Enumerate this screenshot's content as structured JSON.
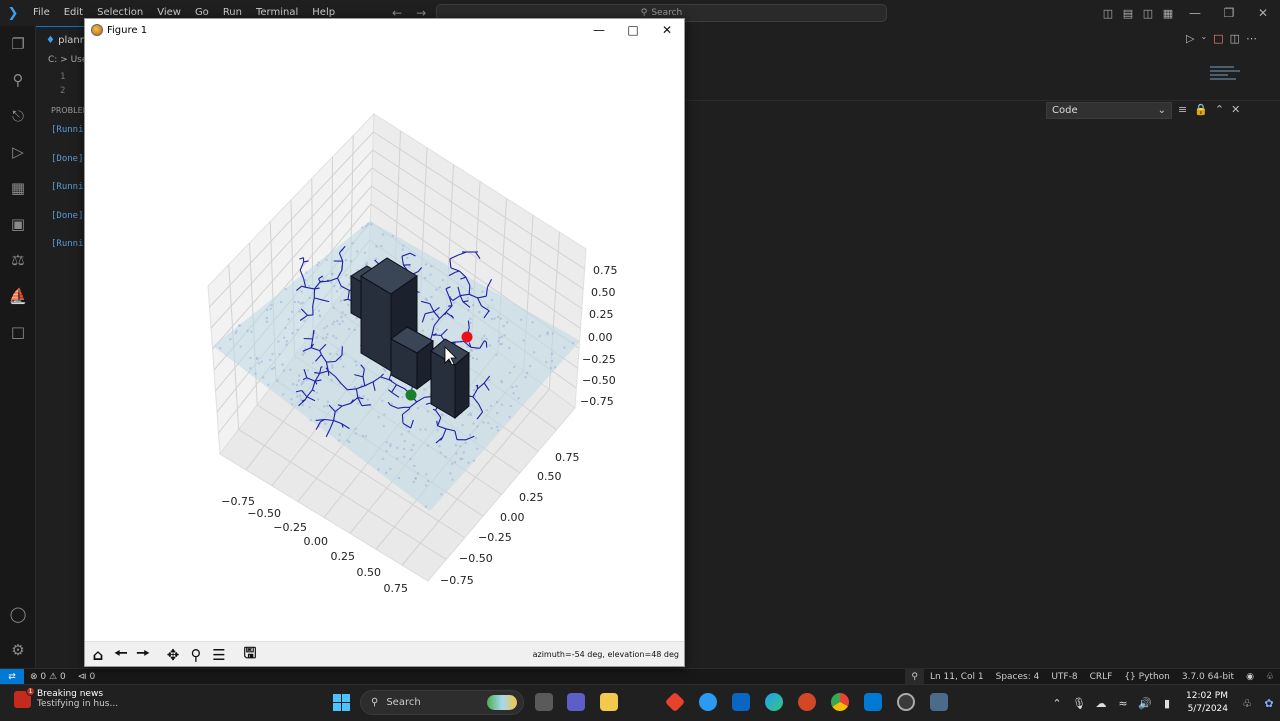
{
  "vscode": {
    "menu": [
      "File",
      "Edit",
      "Selection",
      "View",
      "Go",
      "Run",
      "Terminal",
      "Help"
    ],
    "search_placeholder": "Search",
    "editor_tab": "plann",
    "breadcrumb": "C: > Use",
    "line_numbers": [
      "1",
      "2"
    ],
    "panel_title": "PROBLEM",
    "output_lines": [
      "[Runni",
      "[Done]",
      "[Runni",
      "[Done]",
      "[Runni"
    ],
    "output_channel": "Code"
  },
  "statusbar": {
    "errors": "0",
    "warnings": "0",
    "ports": "0",
    "position": "Ln 11, Col 1",
    "spaces": "Spaces: 4",
    "encoding": "UTF-8",
    "eol": "CRLF",
    "language": "Python",
    "interpreter": "3.7.0 64-bit"
  },
  "figure": {
    "title": "Figure 1",
    "status": "azimuth=-54 deg, elevation=48 deg",
    "z_ticks": [
      "0.75",
      "0.50",
      "0.25",
      "0.00",
      "−0.25",
      "−0.50",
      "−0.75"
    ],
    "x_ticks": [
      "−0.75",
      "−0.50",
      "−0.25",
      "0.00",
      "0.25",
      "0.50",
      "0.75"
    ],
    "y_ticks": [
      "0.75",
      "0.50",
      "0.25",
      "0.00",
      "−0.25",
      "−0.50",
      "−0.75"
    ],
    "colors": {
      "tree": "#1f1fa8",
      "goal": "#e8121c",
      "start": "#18802a",
      "obstacle": "#1c2433"
    }
  },
  "taskbar": {
    "news_title": "Breaking news",
    "news_subtitle": "Testifying in hus...",
    "news_badge": "1",
    "search_label": "Search",
    "time": "12:02 PM",
    "date": "5/7/2024"
  }
}
